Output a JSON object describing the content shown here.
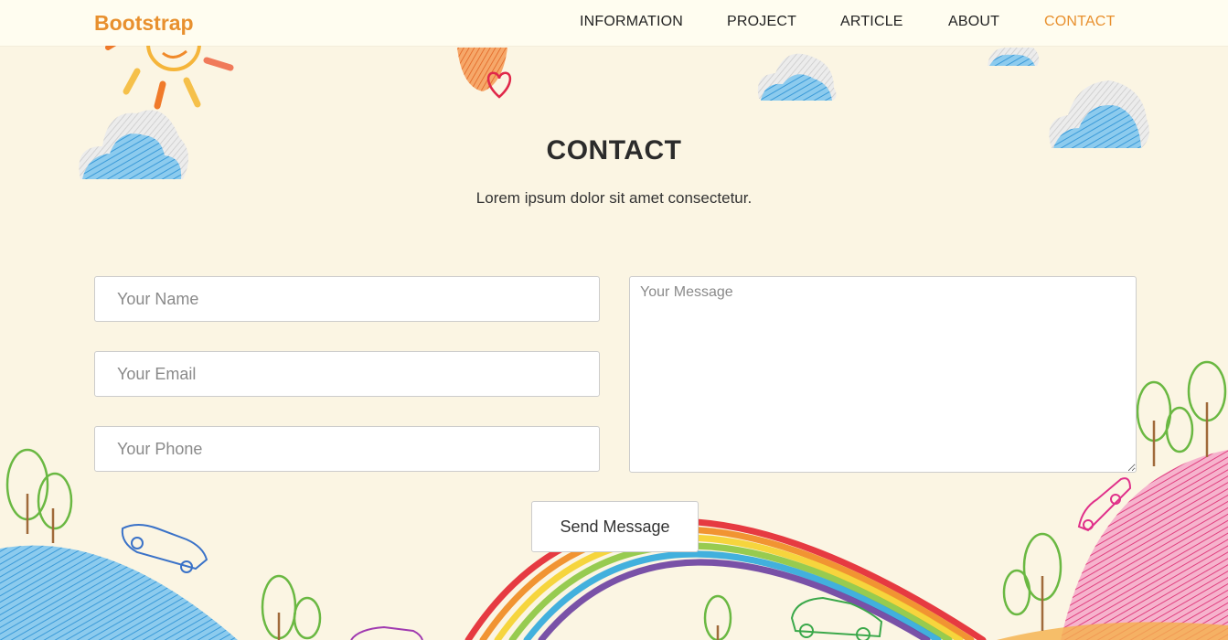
{
  "nav": {
    "brand": "Bootstrap",
    "links": [
      "INFORMATION",
      "PROJECT",
      "ARTICLE",
      "ABOUT",
      "CONTACT"
    ],
    "active": "CONTACT"
  },
  "section": {
    "title": "CONTACT",
    "subtitle": "Lorem ipsum dolor sit amet consectetur."
  },
  "form": {
    "name_placeholder": "Your Name",
    "email_placeholder": "Your Email",
    "phone_placeholder": "Your Phone",
    "message_placeholder": "Your Message",
    "send_label": "Send Message"
  },
  "colors": {
    "accent": "#e8902e",
    "background": "#fbf5e3",
    "navbar": "#fffdf0"
  }
}
